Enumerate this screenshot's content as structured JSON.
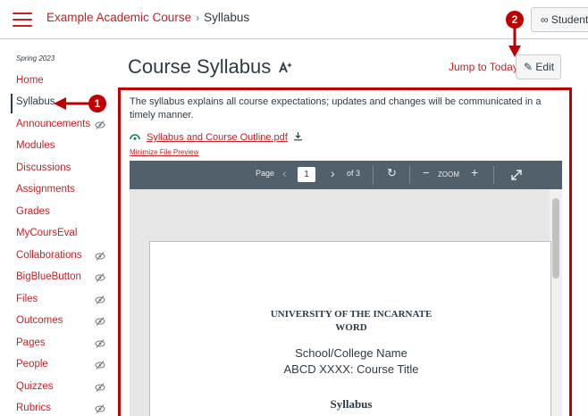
{
  "header": {
    "course_link": "Example Academic Course",
    "separator": "›",
    "current_page": "Syllabus",
    "student_view_label": "Student View"
  },
  "sidebar": {
    "term": "Spring 2023",
    "items": [
      {
        "label": "Home",
        "hidden": false
      },
      {
        "label": "Syllabus",
        "hidden": false,
        "active": true
      },
      {
        "label": "Announcements",
        "hidden": true
      },
      {
        "label": "Modules",
        "hidden": false
      },
      {
        "label": "Discussions",
        "hidden": false
      },
      {
        "label": "Assignments",
        "hidden": false
      },
      {
        "label": "Grades",
        "hidden": false
      },
      {
        "label": "MyCoursEval",
        "hidden": false
      },
      {
        "label": "Collaborations",
        "hidden": true
      },
      {
        "label": "BigBlueButton",
        "hidden": true
      },
      {
        "label": "Files",
        "hidden": true
      },
      {
        "label": "Outcomes",
        "hidden": true
      },
      {
        "label": "Pages",
        "hidden": true
      },
      {
        "label": "People",
        "hidden": true
      },
      {
        "label": "Quizzes",
        "hidden": true
      },
      {
        "label": "Rubrics",
        "hidden": true
      }
    ]
  },
  "callouts": {
    "one": "1",
    "two": "2"
  },
  "main": {
    "title": "Course Syllabus",
    "jump_to_today": "Jump to Today",
    "edit_label": "Edit",
    "description": "The syllabus explains all course expectations; updates and changes will be communicated in a timely manner.",
    "file_name": "Syllabus and Course Outline.pdf",
    "minimize_preview": "Minimize File Preview"
  },
  "viewer": {
    "page_label": "Page",
    "current_page": "1",
    "of_pages": "of 3",
    "zoom_label": "ZOOM"
  },
  "pdf": {
    "university_line1": "UNIVERSITY OF THE INCARNATE",
    "university_line2": "WORD",
    "school": "School/College Name",
    "course": "ABCD XXXX: Course Title",
    "heading": "Syllabus"
  },
  "colors": {
    "accent": "#c71f23",
    "callout": "#c00000",
    "toolbar": "#52606b",
    "text": "#2d3b45"
  }
}
